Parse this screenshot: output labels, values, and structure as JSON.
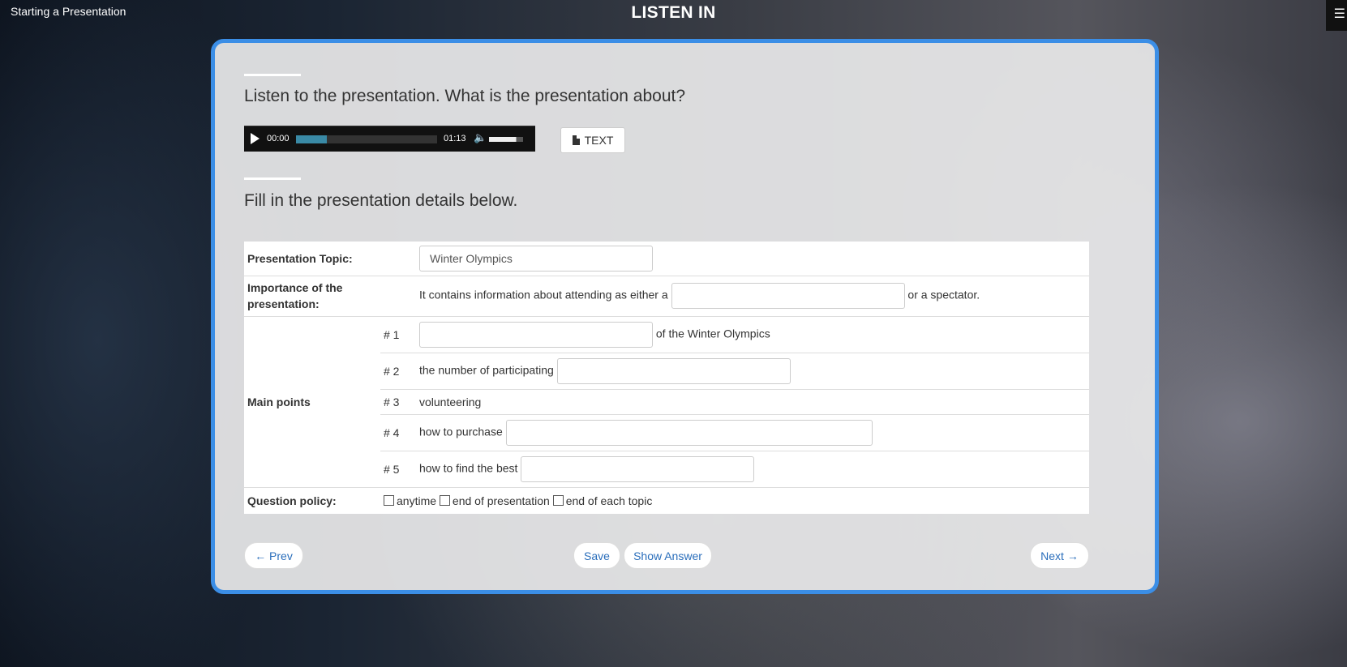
{
  "header": {
    "lesson_title": "Starting a Presentation",
    "section_title": "LISTEN IN",
    "menu_icon": "list-icon"
  },
  "task1": {
    "prompt": "Listen to the presentation. What is the presentation about?",
    "audio": {
      "current_time": "00:00",
      "duration": "01:13",
      "progress": 0,
      "buffered": 0.22,
      "volume": 0.8
    },
    "text_button_label": "TEXT"
  },
  "task2": {
    "prompt": "Fill in the presentation details below.",
    "topic": {
      "label": "Presentation Topic:",
      "value": "Winter Olympics"
    },
    "importance": {
      "label": "Importance of the presentation:",
      "before": "It contains information about attending as either a",
      "value": "",
      "after": "or a spectator."
    },
    "main_points_label": "Main points",
    "points": [
      {
        "num": "# 1",
        "before": "",
        "value": "",
        "after": "of the Winter Olympics"
      },
      {
        "num": "# 2",
        "before": "the number of participating",
        "value": "",
        "after": ""
      },
      {
        "num": "# 3",
        "before": "volunteering",
        "after": ""
      },
      {
        "num": "# 4",
        "before": "how to purchase",
        "value": "",
        "after": ""
      },
      {
        "num": "# 5",
        "before": "how to find the best",
        "value": "",
        "after": ""
      }
    ],
    "policy": {
      "label": "Question policy:",
      "options": [
        {
          "label": "anytime",
          "checked": false
        },
        {
          "label": "end of presentation",
          "checked": false
        },
        {
          "label": "end of each topic",
          "checked": false
        }
      ]
    }
  },
  "buttons": {
    "prev": "← Prev",
    "save": "Save",
    "show_answer": "Show Answer",
    "next": "Next →"
  }
}
